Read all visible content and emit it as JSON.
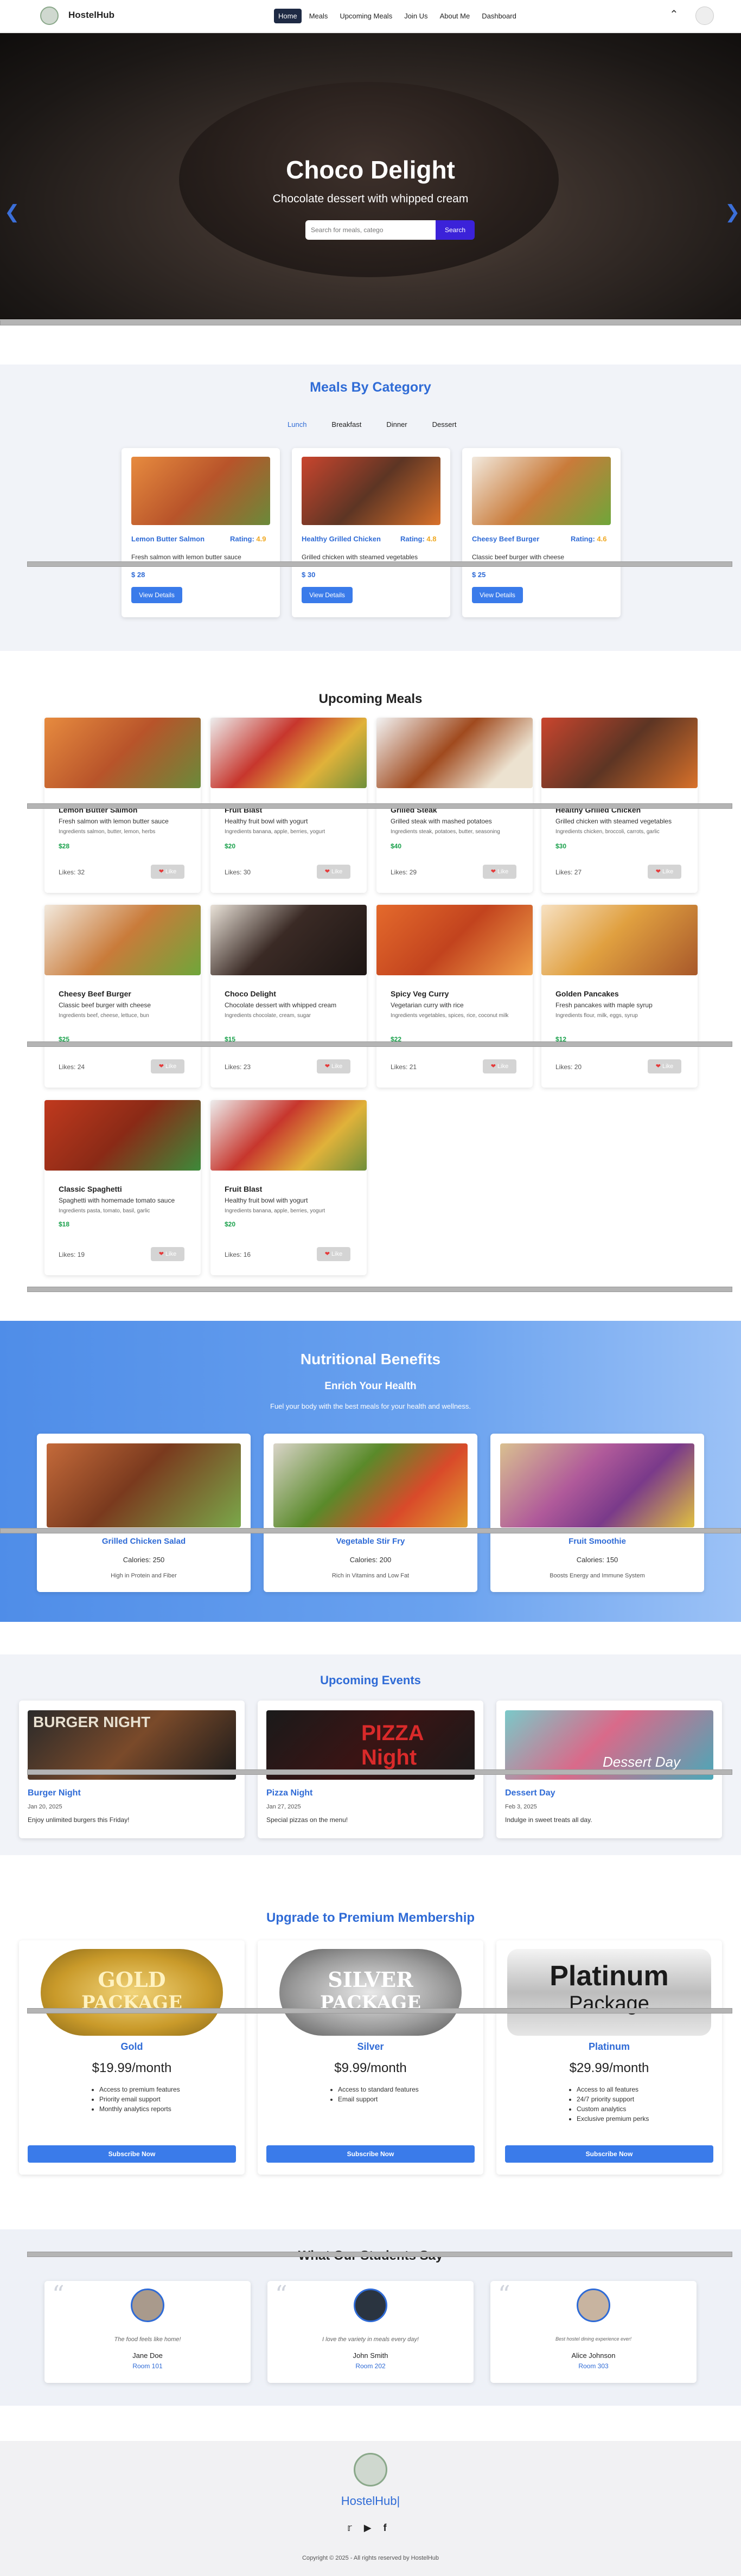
{
  "nav": {
    "brand": "HostelHub",
    "items": [
      "Home",
      "Meals",
      "Upcoming Meals",
      "Join Us",
      "About Me",
      "Dashboard"
    ]
  },
  "hero": {
    "title": "Choco Delight",
    "subtitle": "Chocolate dessert with whipped cream",
    "search_placeholder": "Search for meals, catego",
    "search_button": "Search"
  },
  "categories": {
    "title": "Meals By Category",
    "tabs": [
      "Lunch",
      "Breakfast",
      "Dinner",
      "Dessert"
    ],
    "cards": [
      {
        "title": "Lemon Butter Salmon",
        "rating_label": "Rating:",
        "rating": "4.9",
        "desc": "Fresh salmon with lemon butter sauce",
        "price": "$ 28",
        "button": "View Details"
      },
      {
        "title": "Healthy Grilled Chicken",
        "rating_label": "Rating:",
        "rating": "4.8",
        "desc": "Grilled chicken with steamed vegetables",
        "price": "$ 30",
        "button": "View Details"
      },
      {
        "title": "Cheesy Beef Burger",
        "rating_label": "Rating:",
        "rating": "4.6",
        "desc": "Classic beef burger with cheese",
        "price": "$ 25",
        "button": "View Details"
      }
    ]
  },
  "upcoming": {
    "title": "Upcoming Meals",
    "likes_label": "Likes:",
    "like_button": "Like",
    "meals": [
      {
        "name": "Lemon Butter Salmon",
        "desc": "Fresh salmon with lemon butter sauce",
        "ing": "Ingredients salmon, butter, lemon, herbs",
        "price": "$28",
        "likes": "32"
      },
      {
        "name": "Fruit Blast",
        "desc": "Healthy fruit bowl with yogurt",
        "ing": "Ingredients banana, apple, berries, yogurt",
        "price": "$20",
        "likes": "30"
      },
      {
        "name": "Grilled Steak",
        "desc": "Grilled steak with mashed potatoes",
        "ing": "Ingredients steak, potatoes, butter, seasoning",
        "price": "$40",
        "likes": "29"
      },
      {
        "name": "Healthy Grilled Chicken",
        "desc": "Grilled chicken with steamed vegetables",
        "ing": "Ingredients chicken, broccoli, carrots, garlic",
        "price": "$30",
        "likes": "27"
      },
      {
        "name": "Cheesy Beef Burger",
        "desc": "Classic beef burger with cheese",
        "ing": "Ingredients beef, cheese, lettuce, bun",
        "price": "$25",
        "likes": "24"
      },
      {
        "name": "Choco Delight",
        "desc": "Chocolate dessert with whipped cream",
        "ing": "Ingredients chocolate, cream, sugar",
        "price": "$15",
        "likes": "23"
      },
      {
        "name": "Spicy Veg Curry",
        "desc": "Vegetarian curry with rice",
        "ing": "Ingredients vegetables, spices, rice, coconut milk",
        "price": "$22",
        "likes": "21"
      },
      {
        "name": "Golden Pancakes",
        "desc": "Fresh pancakes with maple syrup",
        "ing": "Ingredients flour, milk, eggs, syrup",
        "price": "$12",
        "likes": "20"
      },
      {
        "name": "Classic Spaghetti",
        "desc": "Spaghetti with homemade tomato sauce",
        "ing": "Ingredients pasta, tomato, basil, garlic",
        "price": "$18",
        "likes": "19"
      },
      {
        "name": "Fruit Blast",
        "desc": "Healthy fruit bowl with yogurt",
        "ing": "Ingredients banana, apple, berries, yogurt",
        "price": "$20",
        "likes": "16"
      }
    ]
  },
  "benefits": {
    "title": "Nutritional Benefits",
    "subtitle": "Enrich Your Health",
    "tagline": "Fuel your body with the best meals for your health and wellness.",
    "cards": [
      {
        "title": "Grilled Chicken Salad",
        "cal": "Calories: 250",
        "note": "High in Protein and Fiber"
      },
      {
        "title": "Vegetable Stir Fry",
        "cal": "Calories: 200",
        "note": "Rich in Vitamins and Low Fat"
      },
      {
        "title": "Fruit Smoothie",
        "cal": "Calories: 150",
        "note": "Boosts Energy and Immune System"
      }
    ]
  },
  "events": {
    "title": "Upcoming Events",
    "items": [
      {
        "title": "Burger Night",
        "date": "Jan 20, 2025",
        "desc": "Enjoy unlimited burgers this Friday!",
        "img_text": "BURGER NIGHT"
      },
      {
        "title": "Pizza Night",
        "date": "Jan 27, 2025",
        "desc": "Special pizzas on the menu!",
        "img_text": "PIZZA Night"
      },
      {
        "title": "Dessert Day",
        "date": "Feb 3, 2025",
        "desc": "Indulge in sweet treats all day.",
        "img_text": "Dessert Day"
      }
    ]
  },
  "premium": {
    "title": "Upgrade to Premium Membership",
    "subscribe": "Subscribe Now",
    "packages": [
      {
        "name": "Gold",
        "price": "$19.99/month",
        "badge_top": "GOLD",
        "badge_bottom": "PACKAGE",
        "features": [
          "Access to premium features",
          "Priority email support",
          "Monthly analytics reports"
        ]
      },
      {
        "name": "Silver",
        "price": "$9.99/month",
        "badge_top": "SILVER",
        "badge_bottom": "PACKAGE",
        "features": [
          "Access to standard features",
          "Email support"
        ]
      },
      {
        "name": "Platinum",
        "price": "$29.99/month",
        "badge_top": "Platinum",
        "badge_bottom": "Package",
        "features": [
          "Access to all features",
          "24/7 priority support",
          "Custom analytics",
          "Exclusive premium perks"
        ]
      }
    ]
  },
  "testimonials": {
    "title": "What Our Students Say",
    "items": [
      {
        "text": "The food feels like home!",
        "name": "Jane Doe",
        "room": "Room 101"
      },
      {
        "text": "I love the variety in meals every day!",
        "name": "John Smith",
        "room": "Room 202"
      },
      {
        "text": "Best hostel dining experience ever!",
        "name": "Alice Johnson",
        "room": "Room 303"
      }
    ]
  },
  "footer": {
    "brand": "HostelHub",
    "copyright": "Copyright © 2025 - All rights reserved by HostelHub",
    "icons": [
      "twitter-icon",
      "youtube-icon",
      "facebook-icon"
    ]
  }
}
